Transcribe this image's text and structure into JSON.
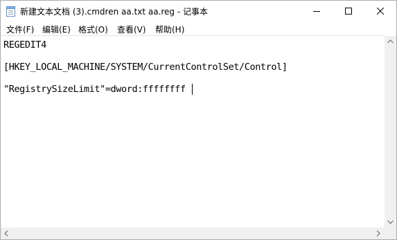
{
  "window": {
    "title": "新建文本文档 (3).cmdren aa.txt aa.reg - 记事本",
    "app_icon": "notepad-icon",
    "controls": {
      "minimize_icon": "minimize-icon",
      "maximize_icon": "maximize-icon",
      "close_icon": "close-icon"
    }
  },
  "menu": {
    "items": [
      {
        "label": "文件(F)"
      },
      {
        "label": "编辑(E)"
      },
      {
        "label": "格式(O)"
      },
      {
        "label": "查看(V)"
      },
      {
        "label": "帮助(H)"
      }
    ]
  },
  "editor": {
    "lines": [
      "REGEDIT4",
      "[HKEY_LOCAL_MACHINE/SYSTEM/CurrentControlSet/Control]",
      "\"RegistrySizeLimit\"=dword:ffffffff"
    ]
  },
  "scrollbars": {
    "vertical": {
      "up_icon": "scroll-up-arrow-icon",
      "down_icon": "scroll-down-arrow-icon"
    },
    "horizontal": {
      "left_icon": "scroll-left-arrow-icon",
      "right_icon": "scroll-right-arrow-icon"
    }
  }
}
